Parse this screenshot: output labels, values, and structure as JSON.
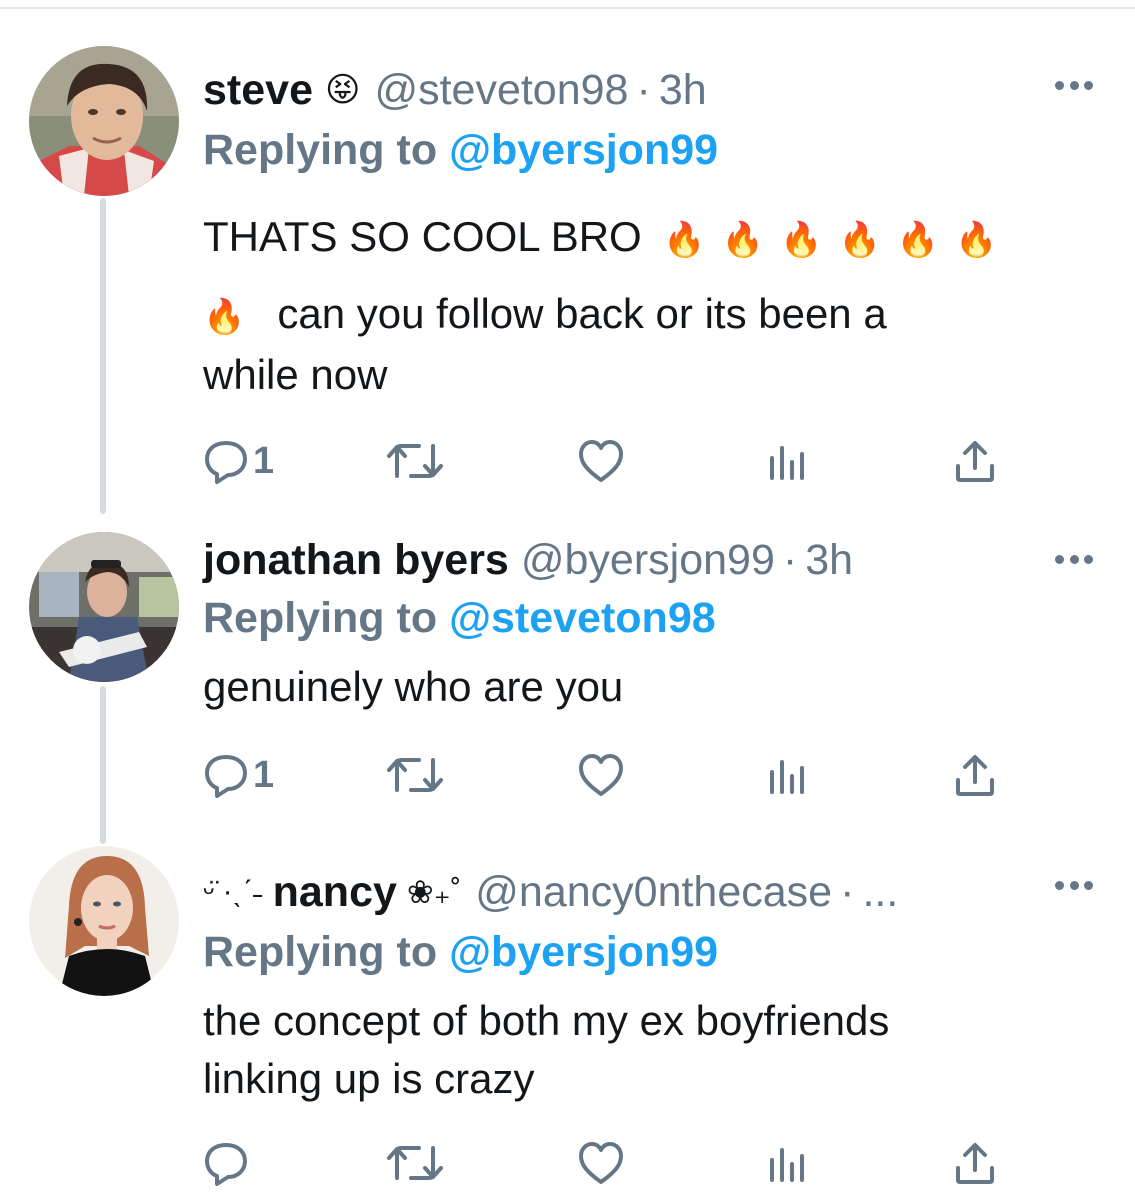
{
  "tweets": [
    {
      "name": "steve",
      "name_emoji": "😝",
      "handle": "@steveton98",
      "time": "3h",
      "replying_label": "Replying to",
      "replying_to": "@byersjon99",
      "text_line1": "THATS SO COOL BRO",
      "text_line2": "can you follow back or its been a",
      "text_line3": "while now",
      "fire_emoji": "🔥",
      "reply_count": "1"
    },
    {
      "name": "jonathan byers",
      "handle": "@byersjon99",
      "time": "3h",
      "replying_label": "Replying to",
      "replying_to": "@steveton98",
      "text_line1": "genuinely who are you",
      "reply_count": "1"
    },
    {
      "name_prefix": "ᵕ̈ ·ˎˊ˗",
      "name": "nancy",
      "name_suffix": "❀₊˚",
      "handle": "@nancy0nthecase",
      "time": "...",
      "replying_label": "Replying to",
      "replying_to": "@byersjon99",
      "text_line1": "the concept of both my ex boyfriends",
      "text_line2": "linking up is crazy",
      "reply_count": ""
    }
  ],
  "time_separator": "·",
  "icons": [
    "reply-icon",
    "retweet-icon",
    "like-icon",
    "analytics-icon",
    "share-icon",
    "more-icon"
  ],
  "colors": {
    "accent": "#1da1f2",
    "muted": "#657786",
    "text": "#14171a",
    "thread_line": "#d6dbdf"
  }
}
